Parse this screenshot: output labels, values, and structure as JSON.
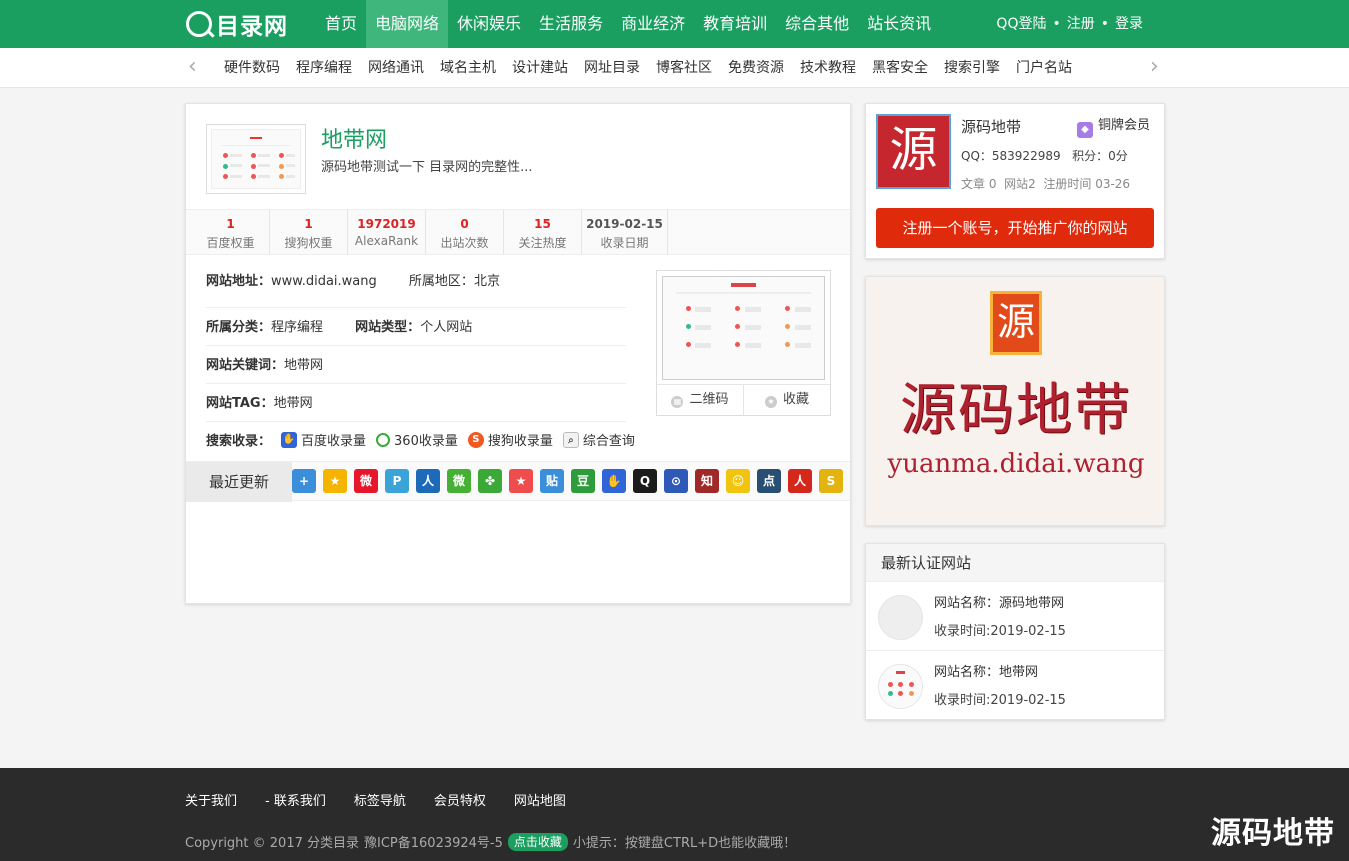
{
  "header": {
    "logo_text": "目录网",
    "nav": [
      "首页",
      "电脑网络",
      "休闲娱乐",
      "生活服务",
      "商业经济",
      "教育培训",
      "综合其他",
      "站长资讯"
    ],
    "active_nav": "电脑网络",
    "user_links": {
      "qq_login": "QQ登陆",
      "register": "注册",
      "login": "登录",
      "sep": "•"
    }
  },
  "subnav": {
    "prev": "‹",
    "next": "›",
    "items": [
      "硬件数码",
      "程序编程",
      "网络通讯",
      "域名主机",
      "设计建站",
      "网址目录",
      "博客社区",
      "免费资源",
      "技术教程",
      "黑客安全",
      "搜索引擎",
      "门户名站"
    ]
  },
  "site": {
    "title": "地带网",
    "desc": "源码地带测试一下 目录网的完整性...",
    "stats": [
      {
        "value": "1",
        "label": "百度权重"
      },
      {
        "value": "1",
        "label": "搜狗权重"
      },
      {
        "value": "1972019",
        "label": "AlexaRank"
      },
      {
        "value": "0",
        "label": "出站次数"
      },
      {
        "value": "15",
        "label": "关注热度"
      },
      {
        "value": "2019-02-15",
        "label": "收录日期"
      }
    ],
    "url_label": "网站地址：",
    "url": "www.didai.wang",
    "region_label": "所属地区：",
    "region": "北京",
    "category_label": "所属分类：",
    "category": "程序编程",
    "type_label": "网站类型：",
    "type": "个人网站",
    "keyword_label": "网站关键词：",
    "keyword": "地带网",
    "tag_label": "网站TAG：",
    "tag": "地带网",
    "qrcode": "二维码",
    "favorite": "收藏",
    "search_label": "搜索收录：",
    "search_links": [
      "百度收录量",
      "360收录量",
      "搜狗收录量",
      "综合查询"
    ],
    "recent_label": "最近更新"
  },
  "share_icons": [
    {
      "name": "plus-share-icon",
      "glyph": "+",
      "color": "#3b8ed9"
    },
    {
      "name": "qzone-icon",
      "glyph": "★",
      "color": "#f5b400"
    },
    {
      "name": "weibo-icon",
      "glyph": "微",
      "color": "#e6162d"
    },
    {
      "name": "tencent-weibo-icon",
      "glyph": "P",
      "color": "#3aa4d8"
    },
    {
      "name": "renren-icon",
      "glyph": "人",
      "color": "#1c6ab8"
    },
    {
      "name": "wechat-icon",
      "glyph": "微",
      "color": "#45b035"
    },
    {
      "name": "kaixin-icon",
      "glyph": "✤",
      "color": "#3aa937"
    },
    {
      "name": "star-icon",
      "glyph": "★",
      "color": "#ef4d4d"
    },
    {
      "name": "tieba-icon",
      "glyph": "贴",
      "color": "#3b8ed9"
    },
    {
      "name": "douban-icon",
      "glyph": "豆",
      "color": "#2d9c3a"
    },
    {
      "name": "baidu-icon",
      "glyph": "✋",
      "color": "#2f65d6"
    },
    {
      "name": "qq-icon",
      "glyph": "Q",
      "color": "#1b1b1b"
    },
    {
      "name": "bookmark-icon",
      "glyph": "⊙",
      "color": "#2e59b9"
    },
    {
      "name": "zhihu-icon",
      "glyph": "知",
      "color": "#a12828"
    },
    {
      "name": "face-icon",
      "glyph": "☺",
      "color": "#f1c40f"
    },
    {
      "name": "diandian-icon",
      "glyph": "点",
      "color": "#284e72"
    },
    {
      "name": "renren-red-icon",
      "glyph": "人",
      "color": "#d5281d"
    },
    {
      "name": "sohu-icon",
      "glyph": "S",
      "color": "#e3b30f"
    }
  ],
  "member": {
    "avatar_char": "源",
    "name": "源码地带",
    "badge": "铜牌会员",
    "qq": "QQ：583922989",
    "points": "积分：0分",
    "articles": "文章 0",
    "sites": "网站2",
    "reg_time": "注册时间 03-26",
    "register_button": "注册一个账号，开始推广你的网站"
  },
  "banner": {
    "seal_char": "源",
    "title": "源码地带",
    "url": "yuanma.didai.wang"
  },
  "certified": {
    "title": "最新认证网站",
    "items": [
      {
        "name_label": "网站名称：",
        "name": "源码地带网",
        "time": "收录时间:2019-02-15"
      },
      {
        "name_label": "网站名称：",
        "name": "地带网",
        "time": "收录时间:2019-02-15"
      }
    ]
  },
  "footer": {
    "links": [
      "关于我们",
      "- 联系我们",
      "标签导航",
      "会员特权",
      "网站地图"
    ],
    "copyright": "Copyright © 2017 分类目录",
    "icp": "豫ICP备16023924号-5",
    "fav_button": "点击收藏",
    "tip": "小提示：按键盘CTRL+D也能收藏哦！"
  },
  "watermark": "源码地带",
  "colors": {
    "brand": "#1a9f61",
    "accent": "#e02a0c",
    "stat": "#dd2222"
  }
}
